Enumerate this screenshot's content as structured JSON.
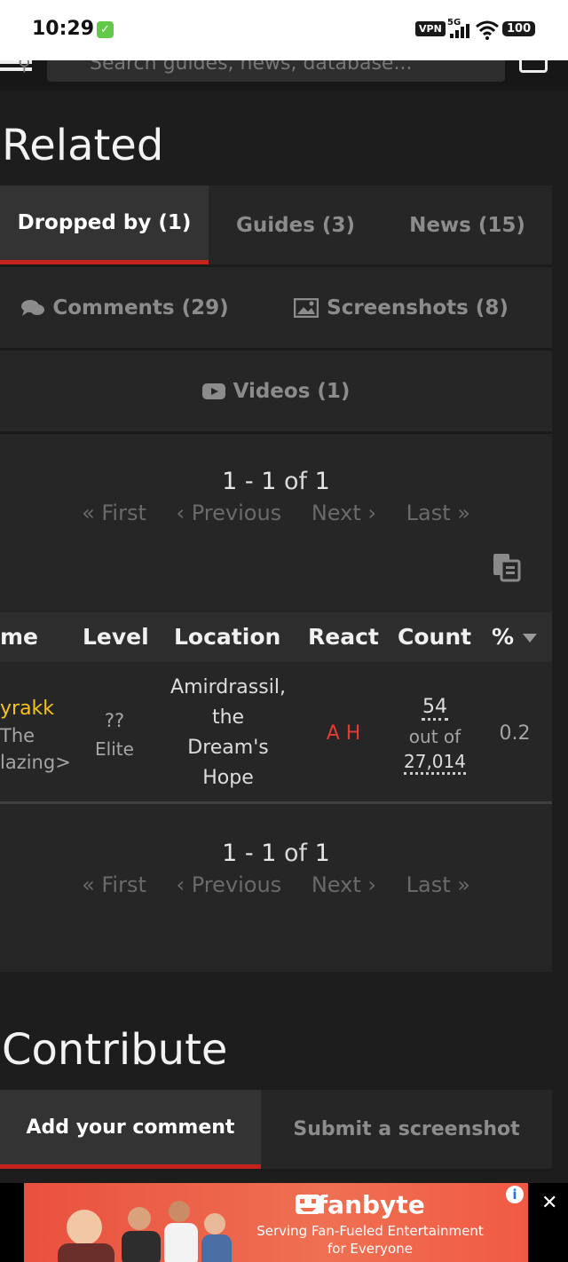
{
  "status": {
    "time": "10:29",
    "vpn": "VPN",
    "network": "5G",
    "battery": "100"
  },
  "header": {
    "search_placeholder": "Search guides, news, database..."
  },
  "related": {
    "title": "Related",
    "tabs": {
      "dropped_by": "Dropped by (1)",
      "guides": "Guides (3)",
      "news": "News (15)",
      "comments": "Comments (29)",
      "screenshots": "Screenshots (8)",
      "videos": "Videos (1)"
    }
  },
  "pager": {
    "range": "1 - 1",
    "of_word": "of",
    "total": "1",
    "first": "« First",
    "previous": "‹ Previous",
    "next": "Next ›",
    "last": "Last »"
  },
  "table": {
    "headers": {
      "name": "me",
      "level": "Level",
      "location": "Location",
      "react": "React",
      "count": "Count",
      "percent": "%"
    },
    "row": {
      "name": "yrakk",
      "title_line1": "The",
      "title_line2": "lazing>",
      "level": "??",
      "classification": "Elite",
      "location_lines": [
        "Amirdrassil,",
        "the",
        "Dream's",
        "Hope"
      ],
      "react_a": "A",
      "react_h": "H",
      "count": "54",
      "out_of": "out of",
      "count_total": "27,014",
      "percent": "0.2"
    }
  },
  "contribute": {
    "title": "Contribute",
    "tabs": {
      "add_comment": "Add your comment",
      "submit_screenshot": "Submit a screenshot"
    }
  },
  "ad": {
    "brand": "fanbyte",
    "tagline_line1": "Serving Fan-Fueled Entertainment",
    "tagline_line2": "for Everyone"
  },
  "colors": {
    "accent_red": "#c5221d",
    "npc_name": "#f5c31c",
    "react_red": "#e23b35"
  }
}
